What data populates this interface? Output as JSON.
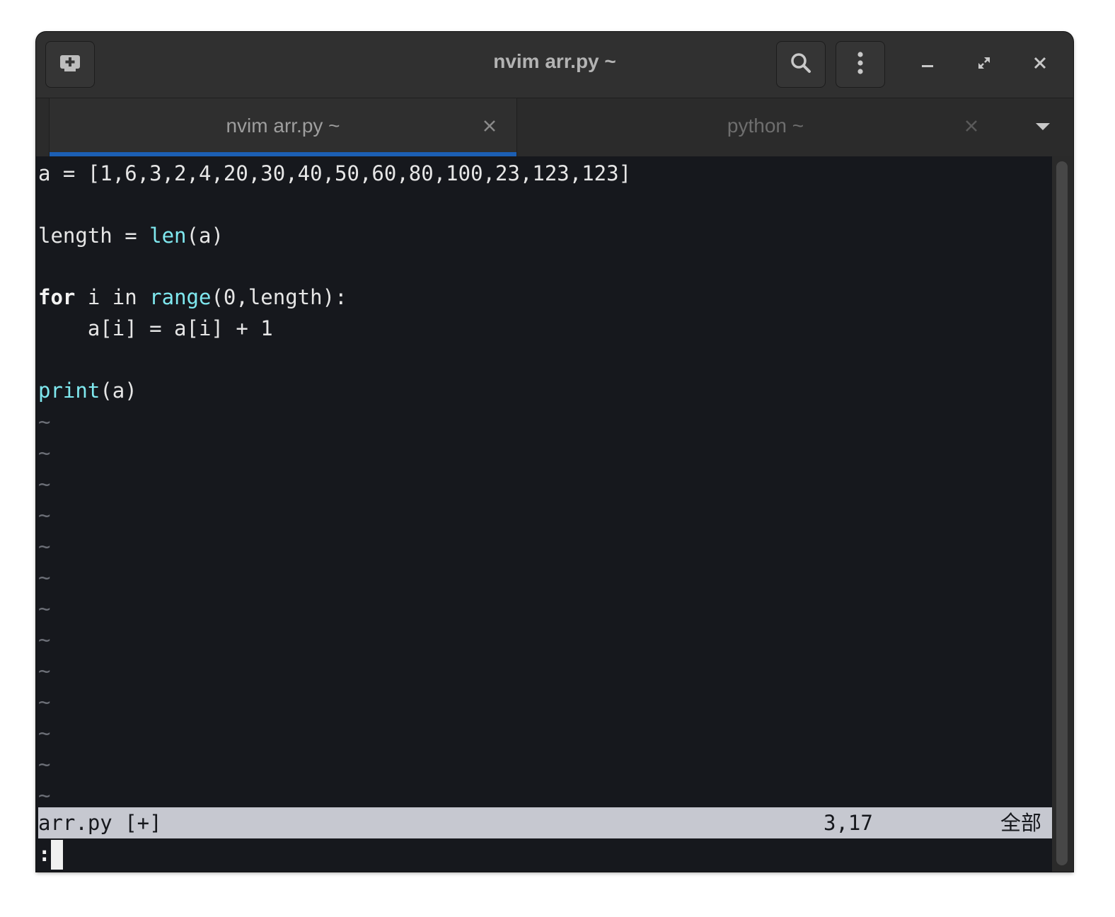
{
  "window": {
    "title": "nvim arr.py ~"
  },
  "headerbar": {
    "new_tab_icon": "new-tab-icon",
    "search_icon": "search-icon",
    "menu_icon": "kebab-menu-icon",
    "minimize_icon": "minimize-icon",
    "maximize_icon": "maximize-icon",
    "close_icon": "close-icon"
  },
  "tabs": [
    {
      "label": "nvim arr.py ~",
      "active": true,
      "close": "×"
    },
    {
      "label": "python ~",
      "active": false,
      "close": "×"
    }
  ],
  "editor": {
    "lines": {
      "l1": "a = [1,6,3,2,4,20,30,40,50,60,80,100,23,123,123]",
      "l3_pre": "length = ",
      "l3_fn": "len",
      "l3_post": "(a)",
      "l5_kw": "for",
      "l5_mid": " i in ",
      "l5_fn": "range",
      "l5_post": "(0,length):",
      "l6": "    a[i] = a[i] + 1",
      "l8_fn": "print",
      "l8_post": "(a)"
    },
    "tilde": "~",
    "statusline": {
      "file": "arr.py [+]",
      "position": "3,17",
      "scroll": "全部"
    },
    "cmdline": ":"
  },
  "colors": {
    "accent": "#1c5fb4",
    "terminal_bg": "#16181d",
    "function": "#7fe8ef",
    "statusline_bg": "#c6c8d0"
  }
}
